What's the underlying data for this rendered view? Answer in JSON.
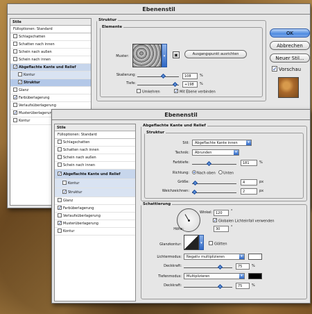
{
  "back_dialog": {
    "title": "Ebenenstil",
    "left_list": {
      "header": "Stile",
      "items": [
        {
          "label": "Fülloptionen: Standard",
          "check": ""
        },
        {
          "label": "Schlagschatten",
          "check": ""
        },
        {
          "label": "Schatten nach innen",
          "check": ""
        },
        {
          "label": "Schein nach außen",
          "check": ""
        },
        {
          "label": "Schein nach innen",
          "check": ""
        },
        {
          "label": "Abgeflachte Kante und Relief",
          "check": "✓"
        },
        {
          "label": "Kontur",
          "check": ""
        },
        {
          "label": "Struktur",
          "check": "✓"
        },
        {
          "label": "Glanz",
          "check": ""
        },
        {
          "label": "Farbüberlagerung",
          "check": "✓"
        },
        {
          "label": "Verlaufsüberlagerung",
          "check": ""
        },
        {
          "label": "Musterüberlagerung",
          "check": "✓"
        },
        {
          "label": "Kontur",
          "check": ""
        }
      ]
    },
    "structure": {
      "legend": "Struktur",
      "sub_legend": "Elemente",
      "pattern_label": "Muster:",
      "snap_button": "Ausgangspunkt ausrichten",
      "scale_label": "Skalierung:",
      "scale_value": "108",
      "depth_label": "Tiefe:",
      "depth_value": "+198",
      "unit": "%",
      "invert_label": "Umkehren",
      "link_label": "Mit Ebene verbinden",
      "link_check": "✓"
    },
    "buttons": {
      "ok": "OK",
      "cancel": "Abbrechen",
      "new_style": "Neuer Stil...",
      "preview": "Vorschau",
      "preview_check": "✓"
    }
  },
  "front_dialog": {
    "title": "Ebenenstil",
    "left_list": {
      "header": "Stile",
      "items": [
        {
          "label": "Fülloptionen: Standard",
          "check": ""
        },
        {
          "label": "Schlagschatten",
          "check": ""
        },
        {
          "label": "Schatten nach innen",
          "check": ""
        },
        {
          "label": "Schein nach außen",
          "check": ""
        },
        {
          "label": "Schein nach innen",
          "check": ""
        },
        {
          "label": "Abgeflachte Kante und Relief",
          "check": "✓"
        },
        {
          "label": "Kontur",
          "check": ""
        },
        {
          "label": "Struktur",
          "check": "✓"
        },
        {
          "label": "Glanz",
          "check": ""
        },
        {
          "label": "Farbüberlagerung",
          "check": "✓"
        },
        {
          "label": "Verlaufsüberlagerung",
          "check": ""
        },
        {
          "label": "Musterüberlagerung",
          "check": "✓"
        },
        {
          "label": "Kontur",
          "check": ""
        }
      ]
    },
    "bevel": {
      "legend": "Abgeflachte Kante und Relief",
      "structure_legend": "Struktur",
      "style_label": "Stil:",
      "style_value": "Abgeflachte Kante innen",
      "technique_label": "Technik:",
      "technique_value": "Abrunden",
      "depth_label": "Farbtiefe:",
      "depth_value": "181",
      "depth_unit": "%",
      "direction_label": "Richtung:",
      "dir_up": "Nach oben",
      "dir_down": "Unten",
      "size_label": "Größe:",
      "size_value": "4",
      "size_unit": "px",
      "soften_label": "Weichzeichnen:",
      "soften_value": "2",
      "soften_unit": "px"
    },
    "shading": {
      "legend": "Schattierung",
      "angle_label": "Winkel:",
      "angle_value": "120",
      "angle_unit": "°",
      "global_light_label": "Globalen Lichteinfall verwenden",
      "global_light_check": "✓",
      "altitude_label": "Höhe:",
      "altitude_value": "30",
      "altitude_unit": "°",
      "gloss_label": "Glanzkontur:",
      "smooth_label": "Glätten",
      "highlight_label": "Lichtermodus:",
      "highlight_value": "Negativ multiplizieren",
      "highlight_opacity_label": "Deckkraft:",
      "highlight_opacity_value": "75",
      "shadow_label": "Tiefenmodus:",
      "shadow_value": "Multiplizieren",
      "shadow_opacity_label": "Deckkraft:",
      "shadow_opacity_value": "75",
      "opacity_unit": "%"
    }
  }
}
